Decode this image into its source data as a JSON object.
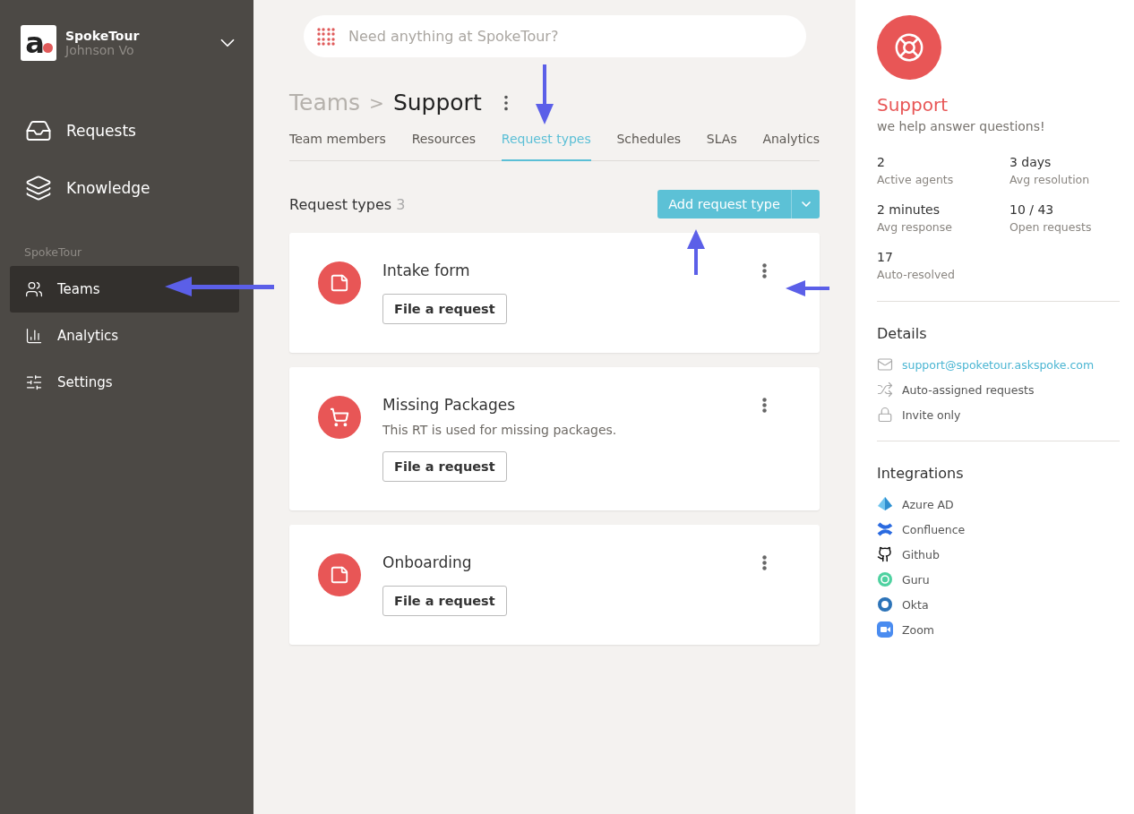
{
  "workspace": {
    "logo_letter": "a",
    "name": "SpokeTour",
    "user": "Johnson Vo"
  },
  "nav": [
    {
      "label": "Requests",
      "kind": "inbox",
      "selected": false
    },
    {
      "label": "Knowledge",
      "kind": "layers",
      "selected": false
    }
  ],
  "section_label": "SpokeTour",
  "section_nav": [
    {
      "label": "Teams",
      "kind": "users",
      "selected": true
    },
    {
      "label": "Analytics",
      "kind": "chart",
      "selected": false
    },
    {
      "label": "Settings",
      "kind": "sliders",
      "selected": false
    }
  ],
  "search": {
    "placeholder": "Need anything at SpokeTour?"
  },
  "breadcrumb": {
    "parent": "Teams",
    "separator": ">",
    "current": "Support"
  },
  "tabs": [
    {
      "label": "Team members",
      "selected": false
    },
    {
      "label": "Resources",
      "selected": false
    },
    {
      "label": "Request types",
      "selected": true
    },
    {
      "label": "Schedules",
      "selected": false
    },
    {
      "label": "SLAs",
      "selected": false
    },
    {
      "label": "Analytics",
      "selected": false
    }
  ],
  "section": {
    "title": "Request types",
    "count": "3",
    "add_button": "Add request type"
  },
  "request_types": [
    {
      "name": "Intake form",
      "kind": "note",
      "button": "File a request"
    },
    {
      "name": "Missing Packages",
      "kind": "cart",
      "description": "This RT is used for missing packages.",
      "button": "File a request"
    },
    {
      "name": "Onboarding",
      "kind": "note",
      "button": "File a request"
    }
  ],
  "team": {
    "name": "Support",
    "tagline": "we help answer questions!"
  },
  "stats": [
    {
      "value": "2",
      "label": "Active agents"
    },
    {
      "value": "3 days",
      "label": "Avg resolution"
    },
    {
      "value": "2 minutes",
      "label": "Avg response"
    },
    {
      "value": "10 / 43",
      "label": "Open requests"
    },
    {
      "value": "17",
      "label": "Auto-resolved"
    }
  ],
  "details": {
    "title": "Details",
    "items": [
      {
        "kind": "email",
        "text": "support@spoketour.askspoke.com"
      },
      {
        "kind": "shuffle",
        "text": "Auto-assigned requests"
      },
      {
        "kind": "lock",
        "text": "Invite only"
      }
    ]
  },
  "integrations": {
    "title": "Integrations",
    "items": [
      {
        "kind": "azure",
        "name": "Azure AD"
      },
      {
        "kind": "confluence",
        "name": "Confluence"
      },
      {
        "kind": "github",
        "name": "Github"
      },
      {
        "kind": "guru",
        "name": "Guru"
      },
      {
        "kind": "okta",
        "name": "Okta"
      },
      {
        "kind": "zoom",
        "name": "Zoom"
      }
    ]
  }
}
